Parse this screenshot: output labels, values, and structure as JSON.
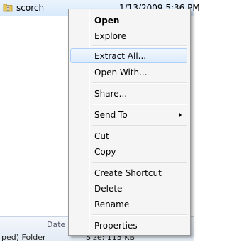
{
  "file_row": {
    "name": "scorch",
    "date": "1/13/2009 5:36 PM",
    "icon": "zipped-folder-icon"
  },
  "details_pane": {
    "date_label": "Date r",
    "type_text": "ped) Folder",
    "size_text": "Size: 113 KB"
  },
  "context_menu": {
    "items": [
      {
        "label": "Open"
      },
      {
        "label": "Explore"
      },
      {
        "label": "Extract All..."
      },
      {
        "label": "Open With..."
      },
      {
        "label": "Share..."
      },
      {
        "label": "Send To"
      },
      {
        "label": "Cut"
      },
      {
        "label": "Copy"
      },
      {
        "label": "Create Shortcut"
      },
      {
        "label": "Delete"
      },
      {
        "label": "Rename"
      },
      {
        "label": "Properties"
      }
    ],
    "default_item": "Open",
    "highlighted_item": "Extract All...",
    "submenu_arrow_icon": "chevron-right-icon"
  },
  "colors": {
    "hover_fill": "#dcebfc",
    "hover_border": "#aecff7",
    "menu_background": "#f5f5f5"
  }
}
